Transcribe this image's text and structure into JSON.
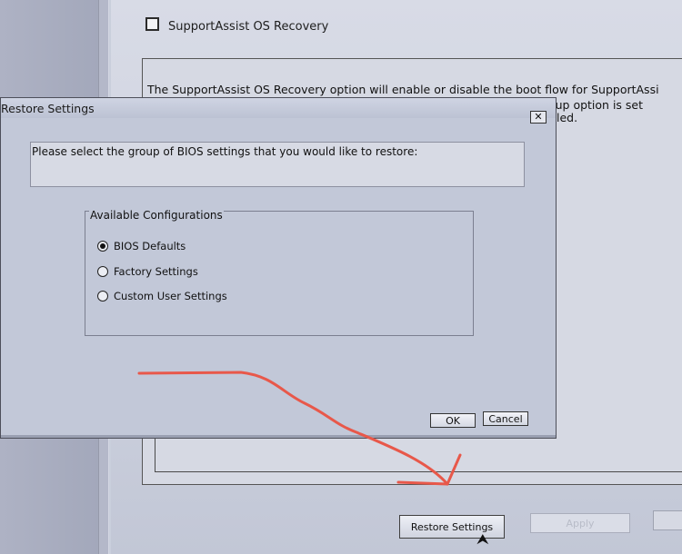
{
  "background": {
    "supportassist_checkbox_label": "SupportAssist OS Recovery",
    "description_line1": "The SupportAssist OS Recovery option will enable or disable the boot flow for SupportAssi",
    "description_line2": "ry setup option is set",
    "description_line3": "led.",
    "buttons": {
      "restore": "Restore Settings",
      "apply": "Apply"
    }
  },
  "dialog": {
    "title": "Restore Settings",
    "close_glyph": "✕",
    "prompt": "Please select the group of BIOS settings that you would like to restore:",
    "group_label": "Available Configurations",
    "options": [
      {
        "label": "BIOS Defaults",
        "selected": true
      },
      {
        "label": "Factory Settings",
        "selected": false
      },
      {
        "label": "Custom User Settings",
        "selected": false
      }
    ],
    "ok_label": "OK",
    "cancel_label": "Cancel"
  },
  "annotation": {
    "arrow_color": "#e8584a"
  },
  "icons": {
    "cursor": "mouse-pointer-icon",
    "close": "close-icon"
  }
}
